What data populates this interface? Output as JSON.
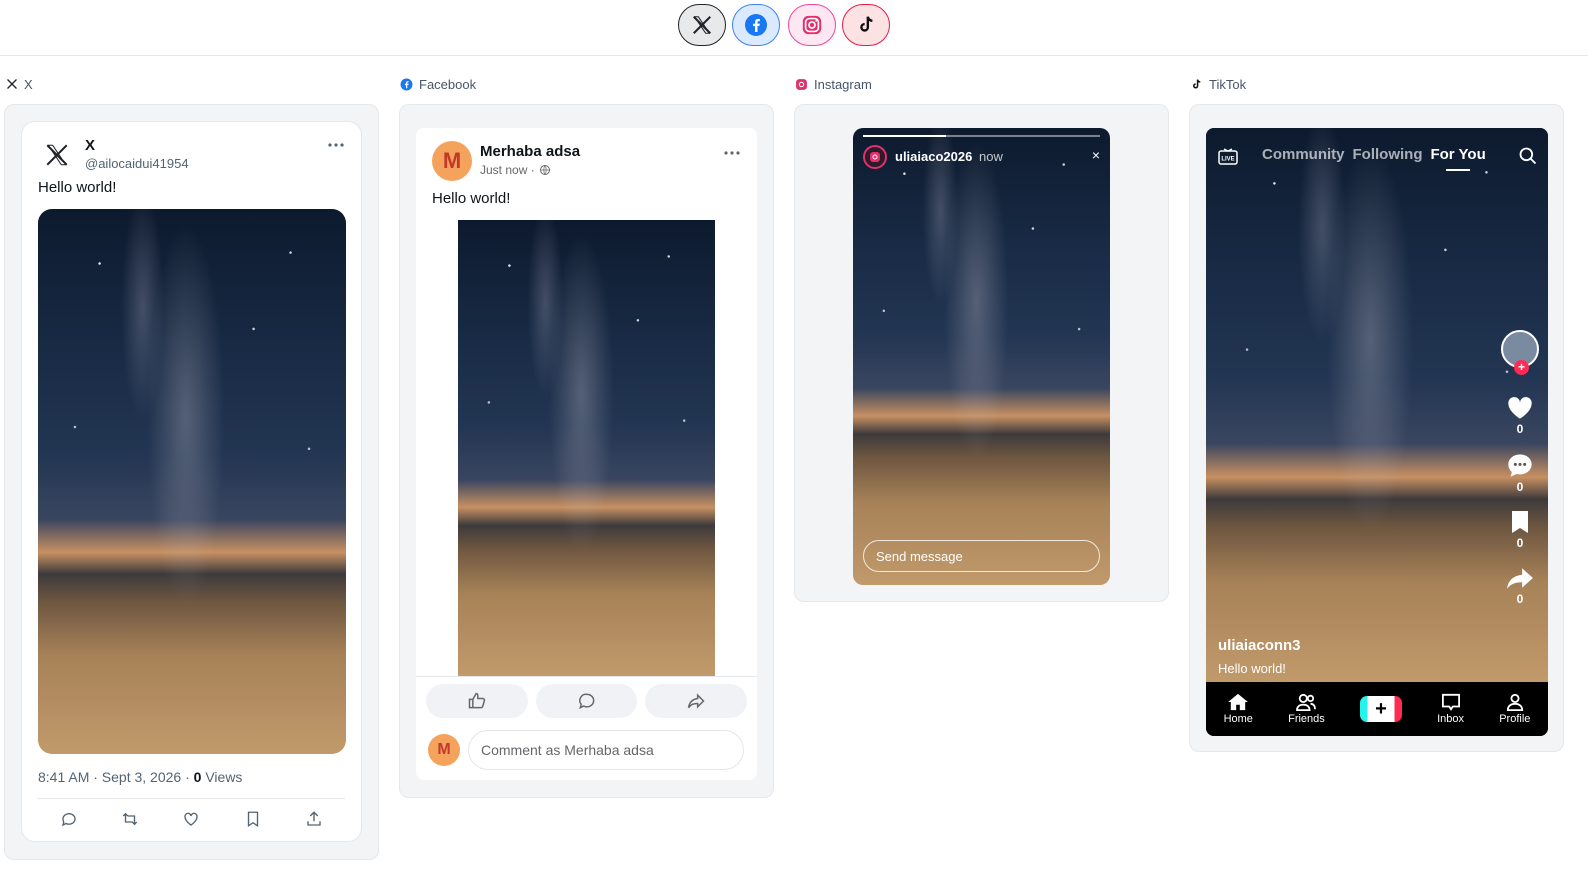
{
  "platform_tabs": [
    {
      "name": "X",
      "icon": "x-logo-icon"
    },
    {
      "name": "Facebook",
      "icon": "facebook-icon"
    },
    {
      "name": "Instagram",
      "icon": "instagram-icon"
    },
    {
      "name": "TikTok",
      "icon": "tiktok-icon"
    }
  ],
  "columns": {
    "x_label": "X",
    "facebook_label": "Facebook",
    "instagram_label": "Instagram",
    "tiktok_label": "TikTok"
  },
  "x_post": {
    "display_name": "X",
    "handle": "@ailocaidui41954",
    "text": "Hello world!",
    "time": "8:41 AM · Sept 3, 2026 · ",
    "views_count": "0",
    "views_label": " Views",
    "actions": [
      "reply-icon",
      "retweet-icon",
      "like-icon",
      "bookmark-icon",
      "share-icon"
    ]
  },
  "facebook_post": {
    "avatar_letter": "M",
    "name": "Merhaba adsa",
    "time": "Just now ·",
    "text": "Hello world!",
    "comment_placeholder": "Comment as Merhaba adsa"
  },
  "instagram_story": {
    "username": "uliaiaco2026",
    "time": "now",
    "close": "×",
    "send_placeholder": "Send message",
    "progress": 0.35
  },
  "tiktok": {
    "tabs": [
      "Community",
      "Following",
      "For You"
    ],
    "active_tab": "For You",
    "like_count": "0",
    "comment_count": "0",
    "bookmark_count": "0",
    "share_count": "0",
    "username": "uliaiaconn3",
    "caption": "Hello world!",
    "bottom_nav": [
      "Home",
      "Friends",
      "+",
      "Inbox",
      "Profile"
    ]
  },
  "colors": {
    "facebook_blue": "#1877f2",
    "instagram_pink": "#e1306c",
    "tiktok_red": "#fe2c55",
    "tiktok_cyan": "#25f4ee"
  }
}
